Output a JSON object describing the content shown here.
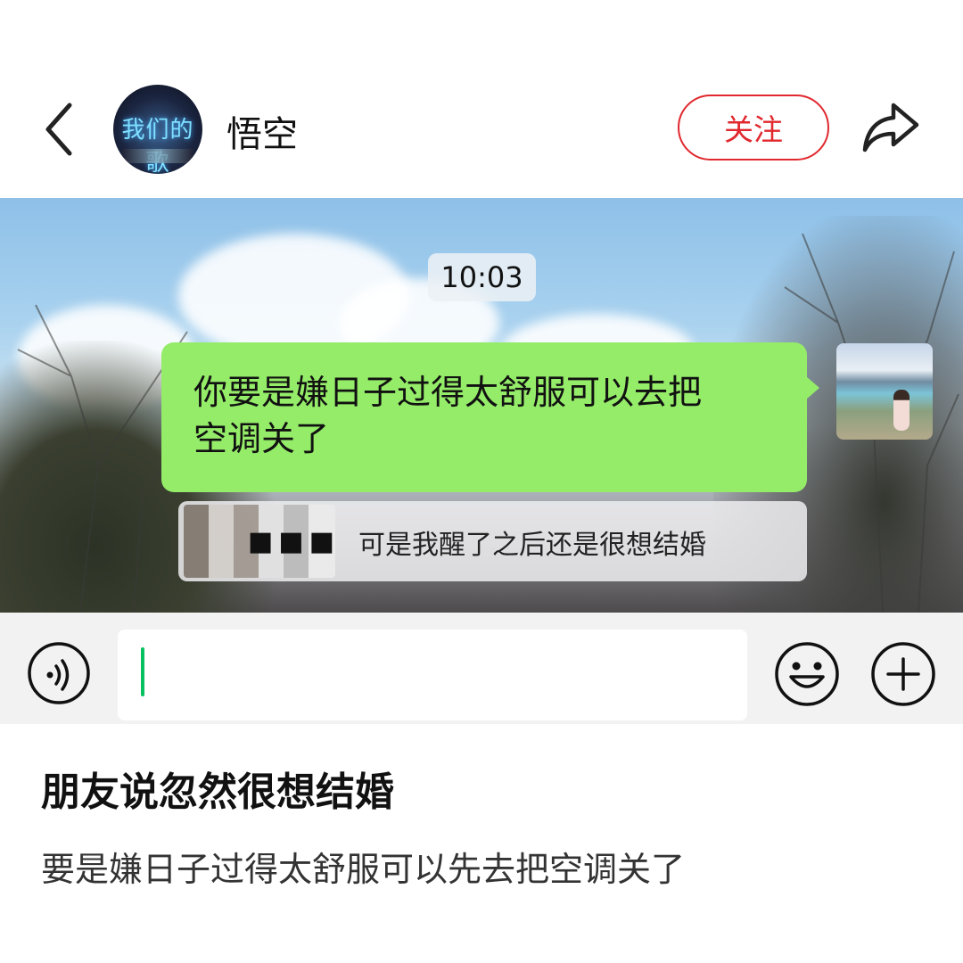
{
  "header": {
    "back_icon": "chevron-left-icon",
    "avatar_text": "我们的歌",
    "username": "悟空",
    "follow_label": "关注",
    "share_icon": "share-arrow-icon"
  },
  "chat": {
    "timestamp": "10:03",
    "sent_message": {
      "line1": "你要是嫌日子过得太舒服可以去把",
      "line2": "空调关了"
    },
    "reply": {
      "sender_dots": "■■■",
      "text": "可是我醒了之后还是很想结婚"
    }
  },
  "input_bar": {
    "voice_icon": "voice-icon",
    "input_value": "",
    "emoji_icon": "emoji-icon",
    "plus_icon": "plus-icon",
    "accent_color": "#07c160"
  },
  "post": {
    "title": "朋友说忽然很想结婚",
    "body": "要是嫌日子过得太舒服可以先去把空调关了"
  },
  "colors": {
    "bubble_green": "#95ec69",
    "follow_red": "#e0282e"
  }
}
